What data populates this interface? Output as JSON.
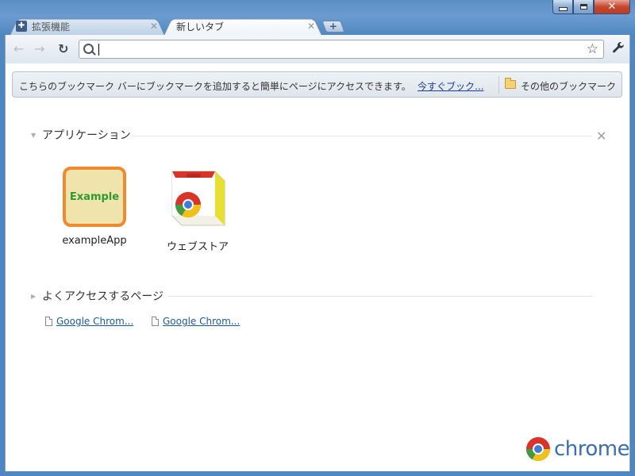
{
  "window": {
    "buttons": {
      "minimize": "",
      "maximize": "",
      "close": "✕"
    }
  },
  "tabs": [
    {
      "title": "拡張機能",
      "icon": "puzzle-icon",
      "active": false
    },
    {
      "title": "新しいタブ",
      "icon": "",
      "active": true
    }
  ],
  "toolbar": {
    "back_icon": "←",
    "forward_icon": "→",
    "reload_icon": "↻",
    "address_value": "",
    "star_icon": "☆",
    "wrench_icon": "🔧"
  },
  "bookmark_bar": {
    "message": "こちらのブックマーク バーにブックマークを追加すると簡単にページにアクセスできます。",
    "import_link": "今すぐブック...",
    "other_bookmarks": "その他のブックマーク"
  },
  "apps_section": {
    "title": "アプリケーション",
    "close_icon": "✕",
    "apps": [
      {
        "name": "exampleApp",
        "icon_text": "Example"
      },
      {
        "name": "ウェブストア"
      }
    ]
  },
  "most_visited": {
    "title": "よくアクセスするページ",
    "items": [
      {
        "title": "Google Chrom..."
      },
      {
        "title": "Google Chrom..."
      }
    ]
  },
  "branding": {
    "wordmark": "chrome"
  }
}
